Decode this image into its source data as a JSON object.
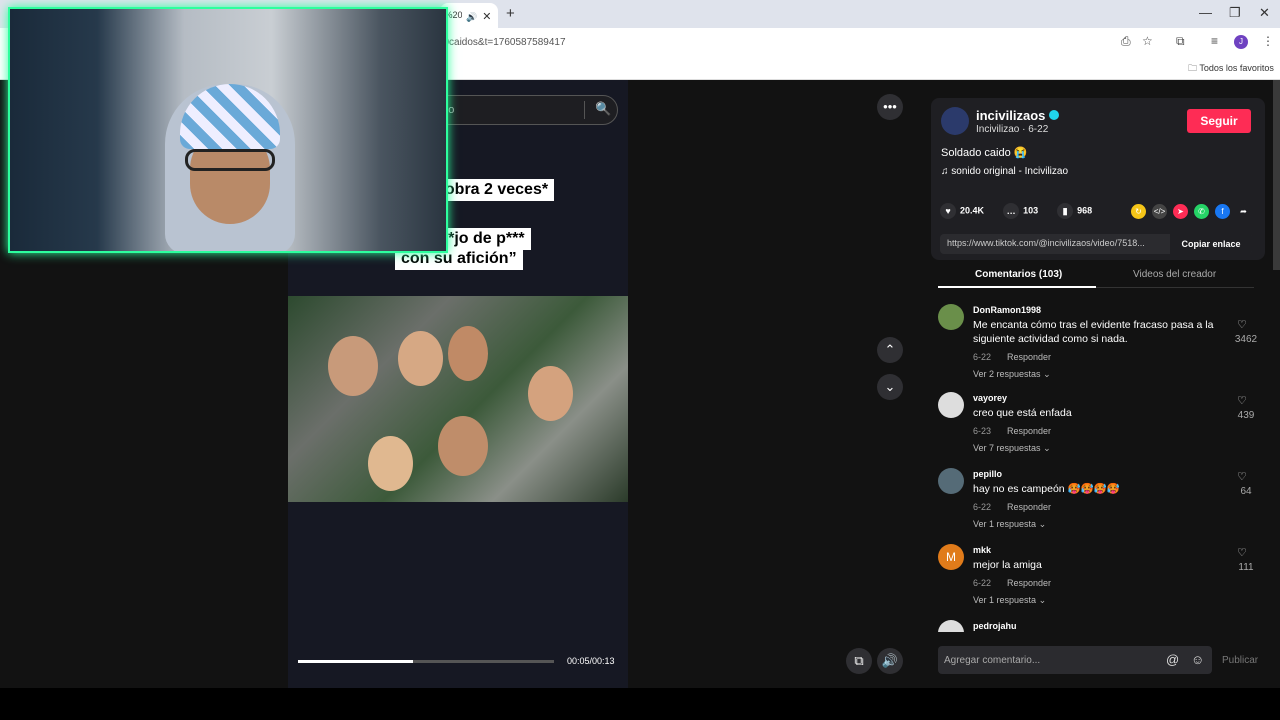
{
  "browser": {
    "tab_title": "s%20caidos",
    "url": "s%20caidos&t=1760587589417",
    "bookmarks_label": "Todos los favoritos",
    "profile_initial": "J"
  },
  "player": {
    "search_placeholder": "ado",
    "caption1": "cobra 2 veces*",
    "caption2": "gar “h*jo de p***",
    "caption3": "con su afición”",
    "time": "00:05/00:13",
    "progress": 0.45
  },
  "post": {
    "username": "incivilizaos",
    "subline": "Incivilizao · 6-22",
    "follow_label": "Seguir",
    "description": "Soldado caido 😭",
    "sound": "sonido original - Incivilizao",
    "likes": "20.4K",
    "comments_count": "103",
    "saves": "968",
    "link": "https://www.tiktok.com/@incivilizaos/video/7518...",
    "copy_label": "Copiar enlace",
    "tab_comments": "Comentarios (103)",
    "tab_creator": "Videos del creador"
  },
  "comments": [
    {
      "user": "DonRamon1998",
      "text": "Me encanta cómo tras el evidente fracaso pasa a la siguiente actividad como si nada.",
      "date": "6-22",
      "reply": "Responder",
      "replies": "Ver 2 respuestas",
      "likes": "3462",
      "color": "#6a8f4a"
    },
    {
      "user": "vayorey",
      "text": "creo que está enfada",
      "date": "6-23",
      "reply": "Responder",
      "replies": "Ver 7 respuestas",
      "likes": "439",
      "color": "#dddddd"
    },
    {
      "user": "pepillo",
      "text": "hay no es campeón 🥵🥵🥵🥵",
      "date": "6-22",
      "reply": "Responder",
      "replies": "Ver 1 respuesta",
      "likes": "64",
      "color": "#556b77"
    },
    {
      "user": "mkk",
      "text": "mejor la amiga",
      "date": "6-22",
      "reply": "Responder",
      "replies": "Ver 1 respuesta",
      "likes": "111",
      "color": "#e07b1a",
      "initial": "M"
    },
    {
      "user": "pedrojahu",
      "text": "",
      "date": "",
      "reply": "",
      "replies": "",
      "likes": "",
      "color": "#dddddd"
    }
  ],
  "composer": {
    "placeholder": "Agregar comentario...",
    "publish_label": "Publicar"
  }
}
